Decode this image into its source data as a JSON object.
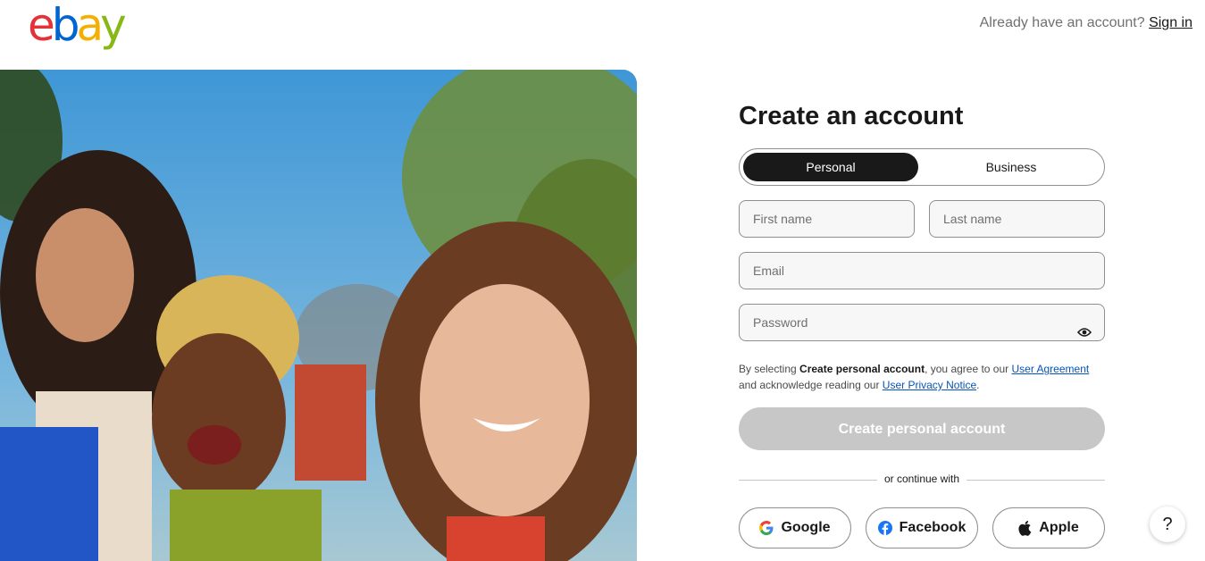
{
  "header": {
    "logo_letters": [
      "e",
      "b",
      "a",
      "y"
    ],
    "logo_colors": [
      "#e53238",
      "#0064d2",
      "#f5af02",
      "#86b817"
    ],
    "account_prompt": "Already have an account?",
    "signin_link": "Sign in"
  },
  "form": {
    "title": "Create an account",
    "account_types": [
      "Personal",
      "Business"
    ],
    "selected_account_type": "Personal",
    "fields": {
      "first_name_placeholder": "First name",
      "last_name_placeholder": "Last name",
      "email_placeholder": "Email",
      "password_placeholder": "Password"
    },
    "legal": {
      "prefix": "By selecting ",
      "bold": "Create personal account",
      "middle": ", you agree to our ",
      "user_agreement": "User Agreement",
      "connector": " and acknowledge reading our ",
      "privacy_notice": "User Privacy Notice",
      "suffix": "."
    },
    "submit_label": "Create personal account",
    "divider_text": "or continue with",
    "social": {
      "google": "Google",
      "facebook": "Facebook",
      "apple": "Apple"
    }
  },
  "help": {
    "label": "?"
  },
  "colors": {
    "primary_dark": "#191919",
    "link_blue": "#0654ba",
    "disabled_button": "#c7c7c7"
  }
}
